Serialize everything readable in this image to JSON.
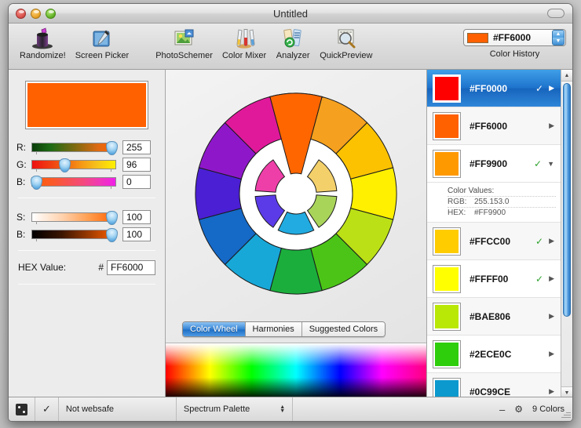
{
  "window": {
    "title": "Untitled"
  },
  "toolbar": {
    "items": [
      {
        "label": "Randomize!",
        "icon": "magic-hat-icon"
      },
      {
        "label": "Screen Picker",
        "icon": "eyedropper-icon"
      },
      {
        "label": "PhotoSchemer",
        "icon": "photo-icon"
      },
      {
        "label": "Color Mixer",
        "icon": "test-tubes-icon"
      },
      {
        "label": "Analyzer",
        "icon": "analyzer-icon"
      },
      {
        "label": "QuickPreview",
        "icon": "magnifier-icon"
      }
    ],
    "color_combo": {
      "value": "#FF6000",
      "swatch": "#FF6000",
      "label": "Color History"
    }
  },
  "left_panel": {
    "preview_color": "#FF6000",
    "rgb_sliders": [
      {
        "label": "R:",
        "value": "255",
        "percent": 100
      },
      {
        "label": "G:",
        "value": "96",
        "percent": 38
      },
      {
        "label": "B:",
        "value": "0",
        "percent": 0
      }
    ],
    "sb_sliders": [
      {
        "label": "S:",
        "value": "100",
        "percent": 100
      },
      {
        "label": "B:",
        "value": "100",
        "percent": 100
      }
    ],
    "hex": {
      "label": "HEX Value:",
      "hash": "#",
      "value": "FF6000"
    }
  },
  "center_panel": {
    "tabs": [
      {
        "label": "Color Wheel",
        "active": true
      },
      {
        "label": "Harmonies",
        "active": false
      },
      {
        "label": "Suggested Colors",
        "active": false
      }
    ],
    "wheel": {
      "outer_colors": [
        "#FF6600",
        "#F5A01E",
        "#FCC200",
        "#FFF000",
        "#BBE016",
        "#4CC417",
        "#1BAE3C",
        "#18A8D8",
        "#1569C7",
        "#4B1FD4",
        "#8E18C9",
        "#E0199B",
        "#ED1C24"
      ],
      "inner_colors": [
        "#F79646",
        "#F3D06A",
        "#A9D45A",
        "#21ABE0",
        "#5B3BE8",
        "#EE3FA8"
      ],
      "segments_outer": 12,
      "segments_inner": 6
    }
  },
  "color_history": {
    "rows": [
      {
        "hex": "#FF0000",
        "swatch": "#FF0000",
        "selected": true,
        "checked": true,
        "expanded": false
      },
      {
        "hex": "#FF6000",
        "swatch": "#FF6000",
        "selected": false,
        "checked": false,
        "expanded": false
      },
      {
        "hex": "#FF9900",
        "swatch": "#FF9900",
        "selected": false,
        "checked": true,
        "expanded": true,
        "detail": {
          "title": "Color Values:",
          "rgb_label": "RGB:",
          "rgb_value": "255.153.0",
          "hex_label": "HEX:",
          "hex_value": "#FF9900"
        }
      },
      {
        "hex": "#FFCC00",
        "swatch": "#FFCC00",
        "selected": false,
        "checked": true,
        "expanded": false
      },
      {
        "hex": "#FFFF00",
        "swatch": "#FFFF00",
        "selected": false,
        "checked": true,
        "expanded": false
      },
      {
        "hex": "#BAE806",
        "swatch": "#BAE806",
        "selected": false,
        "checked": false,
        "expanded": false
      },
      {
        "hex": "#2ECE0C",
        "swatch": "#2ECE0C",
        "selected": false,
        "checked": false,
        "expanded": false
      },
      {
        "hex": "#0C99CE",
        "swatch": "#0C99CE",
        "selected": false,
        "checked": false,
        "expanded": false
      }
    ]
  },
  "status_bar": {
    "dice_icon": "dice-icon",
    "check_icon": "checkmark-icon",
    "websafe_text": "Not websafe",
    "palette_name": "Spectrum Palette",
    "minus_label": "–",
    "gear_icon": "gear-icon",
    "count_text": "9 Colors"
  },
  "icons": {
    "check": "✓",
    "triangle_right": "▶",
    "triangle_down": "▼",
    "arrow_up": "▲",
    "arrow_down": "▼",
    "gear": "⚙"
  }
}
